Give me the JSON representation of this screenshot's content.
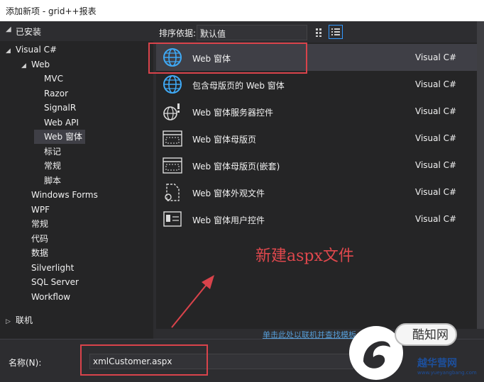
{
  "window": {
    "title": "添加新项 - grid++报表"
  },
  "left_header": {
    "label": "已安装"
  },
  "tree": [
    {
      "label": "Visual C#",
      "level": 0,
      "toggle": "◢",
      "selected": false
    },
    {
      "label": "Web",
      "level": 1,
      "toggle": "◢",
      "selected": false
    },
    {
      "label": "MVC",
      "level": 2,
      "toggle": "",
      "selected": false
    },
    {
      "label": "Razor",
      "level": 2,
      "toggle": "",
      "selected": false
    },
    {
      "label": "SignalR",
      "level": 2,
      "toggle": "",
      "selected": false
    },
    {
      "label": "Web API",
      "level": 2,
      "toggle": "",
      "selected": false
    },
    {
      "label": "Web 窗体",
      "level": 2,
      "toggle": "",
      "selected": true
    },
    {
      "label": "标记",
      "level": 2,
      "toggle": "",
      "selected": false
    },
    {
      "label": "常规",
      "level": 2,
      "toggle": "",
      "selected": false
    },
    {
      "label": "脚本",
      "level": 2,
      "toggle": "",
      "selected": false
    },
    {
      "label": "Windows Forms",
      "level": 1,
      "toggle": "",
      "selected": false
    },
    {
      "label": "WPF",
      "level": 1,
      "toggle": "",
      "selected": false
    },
    {
      "label": "常规",
      "level": 1,
      "toggle": "",
      "selected": false
    },
    {
      "label": "代码",
      "level": 1,
      "toggle": "",
      "selected": false
    },
    {
      "label": "数据",
      "level": 1,
      "toggle": "",
      "selected": false
    },
    {
      "label": "Silverlight",
      "level": 1,
      "toggle": "",
      "selected": false
    },
    {
      "label": "SQL Server",
      "level": 1,
      "toggle": "",
      "selected": false
    },
    {
      "label": "Workflow",
      "level": 1,
      "toggle": "",
      "selected": false
    }
  ],
  "tree_online": {
    "label": "联机",
    "toggle": "▷"
  },
  "toolbar": {
    "sort_label": "排序依据:",
    "sort_value": "默认值"
  },
  "items": [
    {
      "name": "Web 窗体",
      "type": "Visual C#",
      "icon": "globe-icon",
      "selected": true
    },
    {
      "name": "包含母版页的 Web 窗体",
      "type": "Visual C#",
      "icon": "globe-icon",
      "selected": false
    },
    {
      "name": "Web 窗体服务器控件",
      "type": "Visual C#",
      "icon": "globe-control-icon",
      "selected": false
    },
    {
      "name": "Web 窗体母版页",
      "type": "Visual C#",
      "icon": "master-page-icon",
      "selected": false
    },
    {
      "name": "Web 窗体母版页(嵌套)",
      "type": "Visual C#",
      "icon": "master-page-icon",
      "selected": false
    },
    {
      "name": "Web 窗体外观文件",
      "type": "Visual C#",
      "icon": "skin-file-icon",
      "selected": false
    },
    {
      "name": "Web 窗体用户控件",
      "type": "Visual C#",
      "icon": "user-control-icon",
      "selected": false
    }
  ],
  "annotation": {
    "text": "新建aspx文件"
  },
  "link": {
    "text": "单击此处以联机并查找模板"
  },
  "name_field": {
    "label": "名称(N):",
    "value": "xmlCustomer.aspx"
  },
  "watermark": {
    "bubble": "酷知网",
    "brand": "越华营网",
    "url": "www.yueyangbang.com"
  },
  "colors": {
    "accent": "#3399ff",
    "annotation": "#d9434b",
    "background": "#2d2d30"
  }
}
